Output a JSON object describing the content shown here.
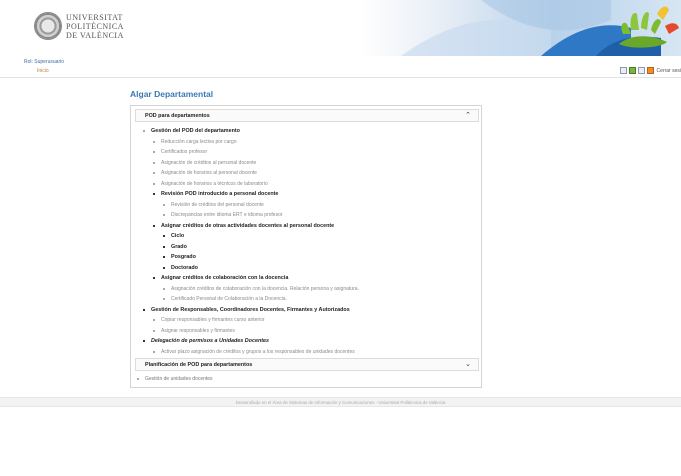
{
  "header": {
    "university_lines": [
      "UNIVERSITAT",
      "POLITÈCNICA",
      "DE VALÈNCIA"
    ]
  },
  "toolbar": {
    "role_link": "Rol: Superusuario",
    "home_link": "Inicio",
    "logout_label": "Cerrar sesi",
    "icons": [
      "window-icon",
      "info-icon",
      "print-icon",
      "logout-icon"
    ]
  },
  "page": {
    "title": "Algar Departamental"
  },
  "panel": {
    "header_label": "POD para departamentos",
    "collapse_icon": "chevron-up-icon",
    "items": [
      {
        "label": "Gestión del POD del departamento",
        "style": "bold",
        "level": 1
      },
      {
        "label": "Reducción carga lectiva por cargo",
        "style": "light",
        "level": 2
      },
      {
        "label": "Certificados profesor",
        "style": "light",
        "level": 2
      },
      {
        "label": "Asignación de créditos al personal docente",
        "style": "light",
        "level": 2
      },
      {
        "label": "Asignación de horarios al personal docente",
        "style": "light",
        "level": 2
      },
      {
        "label": "Asignación de horarios a técnicos de laboratorio",
        "style": "light",
        "level": 2
      },
      {
        "label": "Revisión POD introducido a personal docente",
        "style": "bold",
        "level": 2
      },
      {
        "label": "Revisión de créditos del personal docente",
        "style": "light",
        "level": 3
      },
      {
        "label": "Discrepancias entre idioma ERT e idioma profesor",
        "style": "light",
        "level": 3
      },
      {
        "label": "Asignar créditos de otras actividades docentes al personal docente",
        "style": "bold",
        "level": 2
      },
      {
        "label": "Ciclo",
        "style": "bold",
        "level": 3
      },
      {
        "label": "Grado",
        "style": "bold",
        "level": 3
      },
      {
        "label": "Posgrado",
        "style": "bold",
        "level": 3
      },
      {
        "label": "Doctorado",
        "style": "bold",
        "level": 3
      },
      {
        "label": "Asignar créditos de colaboración con la docencia",
        "style": "bold",
        "level": 2
      },
      {
        "label": "Asignación créditos de colaboración con la docencia. Relación persona y asignatura.",
        "style": "light",
        "level": 3
      },
      {
        "label": "Certificado Personal de Colaboración a la Docencia.",
        "style": "light",
        "level": 3
      },
      {
        "label": "Gestión de Responsables, Coordinadores Docentes, Firmantes y Autorizados",
        "style": "bold",
        "level": 1
      },
      {
        "label": "Copiar responsables y firmantes curso anterior",
        "style": "light",
        "level": 2
      },
      {
        "label": "Asignar responsables y firmantes",
        "style": "light",
        "level": 2
      },
      {
        "label": "Delegación de permisos a Unidades Docentes",
        "style": "bold-italic",
        "level": 1
      },
      {
        "label": "Activar plazo asignación de créditos y grupos a los responsables de unidades docentes",
        "style": "light",
        "level": 2
      }
    ],
    "footer_label": "Planificación de POD para departamentos",
    "expand_icon": "chevron-down-icon",
    "extra_link": "Gestión de unidades docentes"
  },
  "footer": {
    "text": "Desarrollado en el Área de Sistemas de Información y Comunicaciones - Universitat Politècnica de València"
  }
}
